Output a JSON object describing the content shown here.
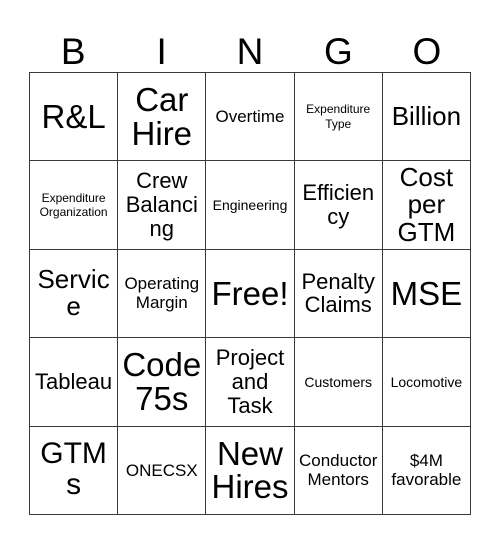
{
  "card": {
    "title": "BINGO",
    "header_letters": [
      "B",
      "I",
      "N",
      "G",
      "O"
    ],
    "free_space_label": "Free!",
    "grid_line_color": "#3a3a3a",
    "background_color": "#ffffff",
    "text_color": "#000000",
    "columns": 5,
    "rows": 5,
    "cells": [
      [
        {
          "label": "R&L",
          "size": "xxl",
          "free": false
        },
        {
          "label": "Car Hire",
          "size": "xxl",
          "free": false
        },
        {
          "label": "Overtime",
          "size": "sm",
          "free": false
        },
        {
          "label": "Expenditure Type",
          "size": "xxs",
          "free": false
        },
        {
          "label": "Billion",
          "size": "lg",
          "free": false
        }
      ],
      [
        {
          "label": "Expenditure Organization",
          "size": "xxs",
          "free": false
        },
        {
          "label": "Crew Balancing",
          "size": "md",
          "free": false
        },
        {
          "label": "Engineering",
          "size": "xs",
          "free": false
        },
        {
          "label": "Efficiency",
          "size": "md",
          "free": false
        },
        {
          "label": "Cost per GTM",
          "size": "lg",
          "free": false
        }
      ],
      [
        {
          "label": "Service",
          "size": "lg",
          "free": false
        },
        {
          "label": "Operating Margin",
          "size": "sm",
          "free": false
        },
        {
          "label": "Free!",
          "size": "xxl",
          "free": true
        },
        {
          "label": "Penalty Claims",
          "size": "md",
          "free": false
        },
        {
          "label": "MSE",
          "size": "xxl",
          "free": false
        }
      ],
      [
        {
          "label": "Tableau",
          "size": "md",
          "free": false
        },
        {
          "label": "Code 75s",
          "size": "xxl",
          "free": false
        },
        {
          "label": "Project and Task",
          "size": "md",
          "free": false
        },
        {
          "label": "Customers",
          "size": "xs",
          "free": false
        },
        {
          "label": "Locomotive",
          "size": "xs",
          "free": false
        }
      ],
      [
        {
          "label": "GTMs",
          "size": "xl",
          "free": false
        },
        {
          "label": "ONECSX",
          "size": "sm",
          "free": false
        },
        {
          "label": "New Hires",
          "size": "xxl",
          "free": false
        },
        {
          "label": "Conductor Mentors",
          "size": "sm",
          "free": false
        },
        {
          "label": "$4M favorable",
          "size": "sm",
          "free": false
        }
      ]
    ]
  }
}
